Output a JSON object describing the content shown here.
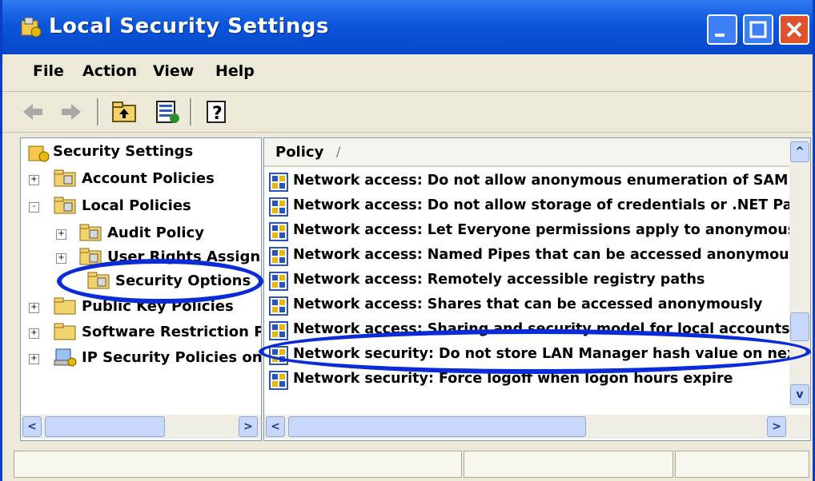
{
  "window": {
    "title": "Local Security Settings"
  },
  "menu": [
    "File",
    "Action",
    "View",
    "Help"
  ],
  "toolbar": {
    "icons": [
      "back-arrow-icon",
      "forward-arrow-icon",
      "up-folder-icon",
      "export-list-icon",
      "help-icon"
    ]
  },
  "tree": {
    "root": "Security Settings",
    "items": [
      {
        "label": "Account Policies",
        "expander": "+"
      },
      {
        "label": "Local Policies",
        "expander": "-"
      },
      {
        "label": "Audit Policy",
        "expander": "+"
      },
      {
        "label": "User Rights Assign",
        "expander": "+"
      },
      {
        "label": "Security Options",
        "expander": ""
      },
      {
        "label": "Public Key Policies",
        "expander": "+"
      },
      {
        "label": "Software Restriction P",
        "expander": "+"
      },
      {
        "label": "IP Security Policies on",
        "expander": "+"
      }
    ]
  },
  "list": {
    "column_header": "Policy",
    "sort_indicator": "/",
    "rows": [
      "Network access: Do not allow anonymous enumeration of SAM a",
      "Network access: Do not allow storage of credentials or .NET Pas",
      "Network access: Let Everyone permissions apply to anonymous",
      "Network access: Named Pipes that can be accessed anonymous",
      "Network access: Remotely accessible registry paths",
      "Network access: Shares that can be accessed anonymously",
      "Network access: Sharing and security model for local accounts",
      "Network security: Do not store LAN Manager hash value on nex",
      "Network security: Force logoff when logon hours expire"
    ],
    "highlighted_row": "Network access: Sharing and security model for local accounts"
  },
  "annotation": {
    "color": "#0a2cd8"
  },
  "colors": {
    "titlebar": "#0a55dc",
    "chrome": "#ece9d8"
  }
}
